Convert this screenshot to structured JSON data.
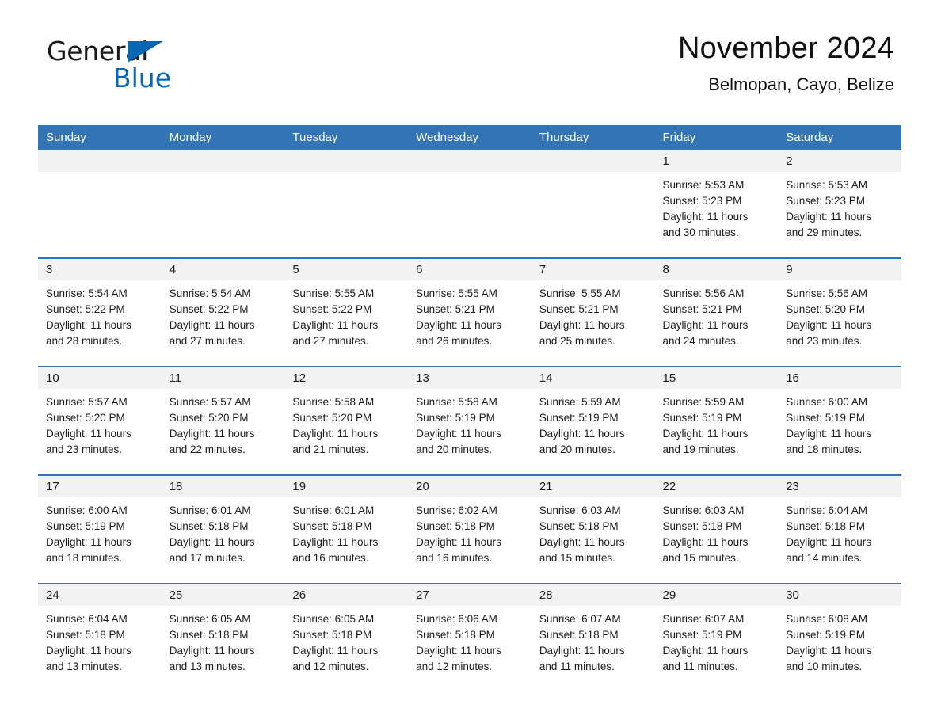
{
  "brand": {
    "word1": "General",
    "word2": "Blue",
    "flag_icon": "triangle-flag-icon",
    "accent_color": "#0b66b2"
  },
  "header": {
    "title": "November 2024",
    "subtitle": "Belmopan, Cayo, Belize"
  },
  "calendar": {
    "header_bg": "#3274b4",
    "daynum_bg": "#f2f2f2",
    "weekday_names": [
      "Sunday",
      "Monday",
      "Tuesday",
      "Wednesday",
      "Thursday",
      "Friday",
      "Saturday"
    ],
    "labels": {
      "sunrise": "Sunrise:",
      "sunset": "Sunset:",
      "daylight": "Daylight:"
    },
    "weeks": [
      [
        {
          "day": ""
        },
        {
          "day": ""
        },
        {
          "day": ""
        },
        {
          "day": ""
        },
        {
          "day": ""
        },
        {
          "day": "1",
          "sunrise": "Sunrise: 5:53 AM",
          "sunset": "Sunset: 5:23 PM",
          "daylight_line1": "Daylight: 11 hours",
          "daylight_line2": "and 30 minutes."
        },
        {
          "day": "2",
          "sunrise": "Sunrise: 5:53 AM",
          "sunset": "Sunset: 5:23 PM",
          "daylight_line1": "Daylight: 11 hours",
          "daylight_line2": "and 29 minutes."
        }
      ],
      [
        {
          "day": "3",
          "sunrise": "Sunrise: 5:54 AM",
          "sunset": "Sunset: 5:22 PM",
          "daylight_line1": "Daylight: 11 hours",
          "daylight_line2": "and 28 minutes."
        },
        {
          "day": "4",
          "sunrise": "Sunrise: 5:54 AM",
          "sunset": "Sunset: 5:22 PM",
          "daylight_line1": "Daylight: 11 hours",
          "daylight_line2": "and 27 minutes."
        },
        {
          "day": "5",
          "sunrise": "Sunrise: 5:55 AM",
          "sunset": "Sunset: 5:22 PM",
          "daylight_line1": "Daylight: 11 hours",
          "daylight_line2": "and 27 minutes."
        },
        {
          "day": "6",
          "sunrise": "Sunrise: 5:55 AM",
          "sunset": "Sunset: 5:21 PM",
          "daylight_line1": "Daylight: 11 hours",
          "daylight_line2": "and 26 minutes."
        },
        {
          "day": "7",
          "sunrise": "Sunrise: 5:55 AM",
          "sunset": "Sunset: 5:21 PM",
          "daylight_line1": "Daylight: 11 hours",
          "daylight_line2": "and 25 minutes."
        },
        {
          "day": "8",
          "sunrise": "Sunrise: 5:56 AM",
          "sunset": "Sunset: 5:21 PM",
          "daylight_line1": "Daylight: 11 hours",
          "daylight_line2": "and 24 minutes."
        },
        {
          "day": "9",
          "sunrise": "Sunrise: 5:56 AM",
          "sunset": "Sunset: 5:20 PM",
          "daylight_line1": "Daylight: 11 hours",
          "daylight_line2": "and 23 minutes."
        }
      ],
      [
        {
          "day": "10",
          "sunrise": "Sunrise: 5:57 AM",
          "sunset": "Sunset: 5:20 PM",
          "daylight_line1": "Daylight: 11 hours",
          "daylight_line2": "and 23 minutes."
        },
        {
          "day": "11",
          "sunrise": "Sunrise: 5:57 AM",
          "sunset": "Sunset: 5:20 PM",
          "daylight_line1": "Daylight: 11 hours",
          "daylight_line2": "and 22 minutes."
        },
        {
          "day": "12",
          "sunrise": "Sunrise: 5:58 AM",
          "sunset": "Sunset: 5:20 PM",
          "daylight_line1": "Daylight: 11 hours",
          "daylight_line2": "and 21 minutes."
        },
        {
          "day": "13",
          "sunrise": "Sunrise: 5:58 AM",
          "sunset": "Sunset: 5:19 PM",
          "daylight_line1": "Daylight: 11 hours",
          "daylight_line2": "and 20 minutes."
        },
        {
          "day": "14",
          "sunrise": "Sunrise: 5:59 AM",
          "sunset": "Sunset: 5:19 PM",
          "daylight_line1": "Daylight: 11 hours",
          "daylight_line2": "and 20 minutes."
        },
        {
          "day": "15",
          "sunrise": "Sunrise: 5:59 AM",
          "sunset": "Sunset: 5:19 PM",
          "daylight_line1": "Daylight: 11 hours",
          "daylight_line2": "and 19 minutes."
        },
        {
          "day": "16",
          "sunrise": "Sunrise: 6:00 AM",
          "sunset": "Sunset: 5:19 PM",
          "daylight_line1": "Daylight: 11 hours",
          "daylight_line2": "and 18 minutes."
        }
      ],
      [
        {
          "day": "17",
          "sunrise": "Sunrise: 6:00 AM",
          "sunset": "Sunset: 5:19 PM",
          "daylight_line1": "Daylight: 11 hours",
          "daylight_line2": "and 18 minutes."
        },
        {
          "day": "18",
          "sunrise": "Sunrise: 6:01 AM",
          "sunset": "Sunset: 5:18 PM",
          "daylight_line1": "Daylight: 11 hours",
          "daylight_line2": "and 17 minutes."
        },
        {
          "day": "19",
          "sunrise": "Sunrise: 6:01 AM",
          "sunset": "Sunset: 5:18 PM",
          "daylight_line1": "Daylight: 11 hours",
          "daylight_line2": "and 16 minutes."
        },
        {
          "day": "20",
          "sunrise": "Sunrise: 6:02 AM",
          "sunset": "Sunset: 5:18 PM",
          "daylight_line1": "Daylight: 11 hours",
          "daylight_line2": "and 16 minutes."
        },
        {
          "day": "21",
          "sunrise": "Sunrise: 6:03 AM",
          "sunset": "Sunset: 5:18 PM",
          "daylight_line1": "Daylight: 11 hours",
          "daylight_line2": "and 15 minutes."
        },
        {
          "day": "22",
          "sunrise": "Sunrise: 6:03 AM",
          "sunset": "Sunset: 5:18 PM",
          "daylight_line1": "Daylight: 11 hours",
          "daylight_line2": "and 15 minutes."
        },
        {
          "day": "23",
          "sunrise": "Sunrise: 6:04 AM",
          "sunset": "Sunset: 5:18 PM",
          "daylight_line1": "Daylight: 11 hours",
          "daylight_line2": "and 14 minutes."
        }
      ],
      [
        {
          "day": "24",
          "sunrise": "Sunrise: 6:04 AM",
          "sunset": "Sunset: 5:18 PM",
          "daylight_line1": "Daylight: 11 hours",
          "daylight_line2": "and 13 minutes."
        },
        {
          "day": "25",
          "sunrise": "Sunrise: 6:05 AM",
          "sunset": "Sunset: 5:18 PM",
          "daylight_line1": "Daylight: 11 hours",
          "daylight_line2": "and 13 minutes."
        },
        {
          "day": "26",
          "sunrise": "Sunrise: 6:05 AM",
          "sunset": "Sunset: 5:18 PM",
          "daylight_line1": "Daylight: 11 hours",
          "daylight_line2": "and 12 minutes."
        },
        {
          "day": "27",
          "sunrise": "Sunrise: 6:06 AM",
          "sunset": "Sunset: 5:18 PM",
          "daylight_line1": "Daylight: 11 hours",
          "daylight_line2": "and 12 minutes."
        },
        {
          "day": "28",
          "sunrise": "Sunrise: 6:07 AM",
          "sunset": "Sunset: 5:18 PM",
          "daylight_line1": "Daylight: 11 hours",
          "daylight_line2": "and 11 minutes."
        },
        {
          "day": "29",
          "sunrise": "Sunrise: 6:07 AM",
          "sunset": "Sunset: 5:19 PM",
          "daylight_line1": "Daylight: 11 hours",
          "daylight_line2": "and 11 minutes."
        },
        {
          "day": "30",
          "sunrise": "Sunrise: 6:08 AM",
          "sunset": "Sunset: 5:19 PM",
          "daylight_line1": "Daylight: 11 hours",
          "daylight_line2": "and 10 minutes."
        }
      ]
    ]
  }
}
